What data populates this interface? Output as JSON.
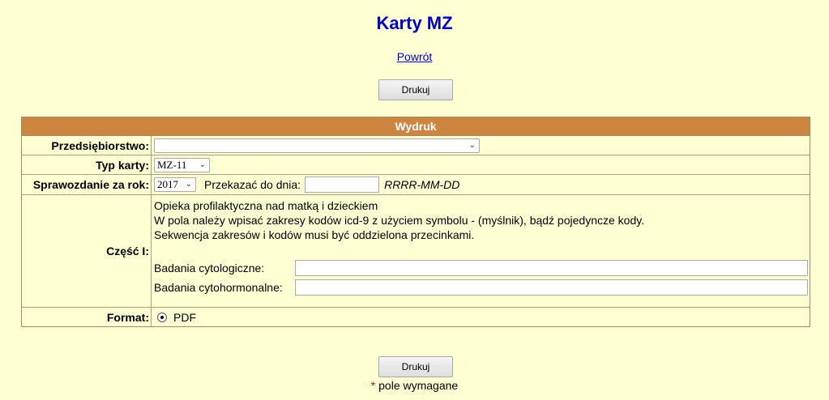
{
  "header": {
    "title": "Karty MZ",
    "back_link": "Powrót"
  },
  "buttons": {
    "print_top": "Drukuj",
    "print_bottom": "Drukuj"
  },
  "form": {
    "section_title": "Wydruk",
    "company": {
      "label": "Przedsiębiorstwo:",
      "value": ""
    },
    "card_type": {
      "label": "Typ karty:",
      "value": "MZ-11"
    },
    "report_year": {
      "label": "Sprawozdanie za rok:",
      "value": "2017",
      "deadline_label": "Przekazać do dnia:",
      "deadline_value": "",
      "date_format_hint": "RRRR-MM-DD"
    },
    "part_one": {
      "label": "Część I:",
      "line1": "Opieka profilaktyczna nad matką i dzieckiem",
      "line2": "W pola należy wpisać zakresy kodów icd-9 z użyciem symbolu - (myślnik), bądź pojedyncze kody.",
      "line3": "Sekwencja zakresów i kodów musi być oddzielona przecinkami.",
      "cytology_label": "Badania cytologiczne:",
      "cytology_value": "",
      "cytohormonal_label": "Badania cytohormonalne:",
      "cytohormonal_value": ""
    },
    "format": {
      "label": "Format:",
      "option": "PDF",
      "selected": true
    }
  },
  "footer": {
    "required_marker": "*",
    "required_text": "pole wymagane"
  },
  "colors": {
    "background": "#ffffd4",
    "header_bar": "#cd853f",
    "title": "#0000cc",
    "required_star": "#dd0000"
  }
}
